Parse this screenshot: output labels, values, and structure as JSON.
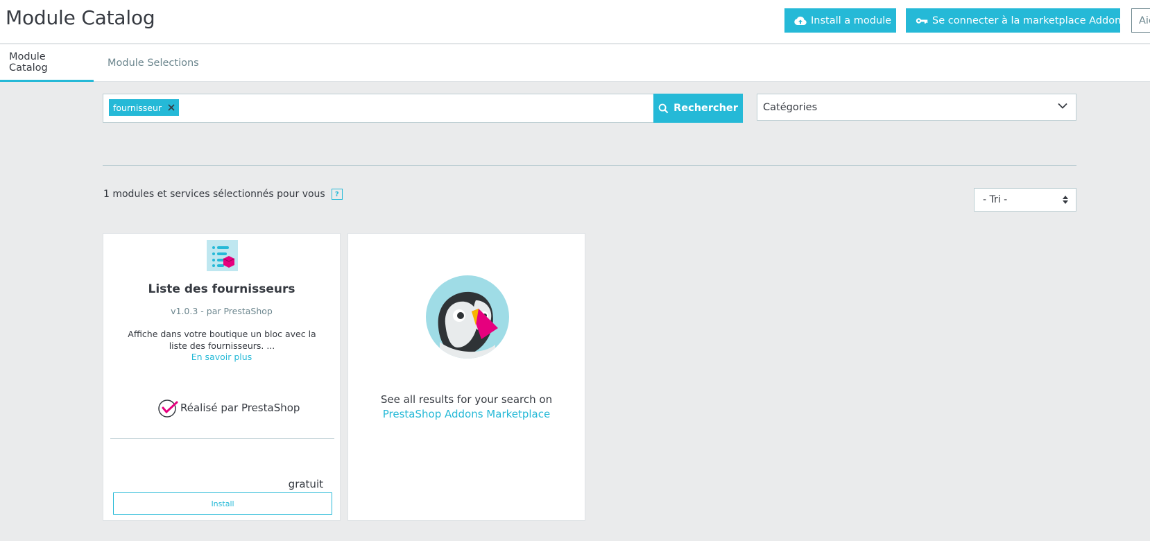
{
  "header": {
    "title": "Module Catalog",
    "install_module_label": "Install a module",
    "addons_connect_label": "Se connecter à la marketplace Addons",
    "help_label": "Aide"
  },
  "tabs": [
    {
      "label": "Module Catalog",
      "active": true
    },
    {
      "label": "Module Selections",
      "active": false
    }
  ],
  "search": {
    "tag": "fournisseur",
    "button_label": "Rechercher"
  },
  "categories": {
    "selected": "Catégories"
  },
  "results": {
    "count_text": "1 modules et services sélectionnés pour vous",
    "help_glyph": "?",
    "sort_selected": "- Tri -"
  },
  "module_card": {
    "title": "Liste des fournisseurs",
    "version": "v1.0.3 - par PrestaShop",
    "description": "Affiche dans votre boutique un bloc avec la liste des fournisseurs. ...",
    "more_link": "En savoir plus",
    "made_by": "Réalisé par PrestaShop",
    "price": "gratuit",
    "install_label": "Install"
  },
  "addons_card": {
    "line1": "See all results for your search on",
    "line2": "PrestaShop Addons Marketplace"
  },
  "colors": {
    "accent": "#25b9d7",
    "background": "#eaebec",
    "text": "#363a41",
    "muted": "#6c868e",
    "badge_pink": "#e6007e"
  }
}
